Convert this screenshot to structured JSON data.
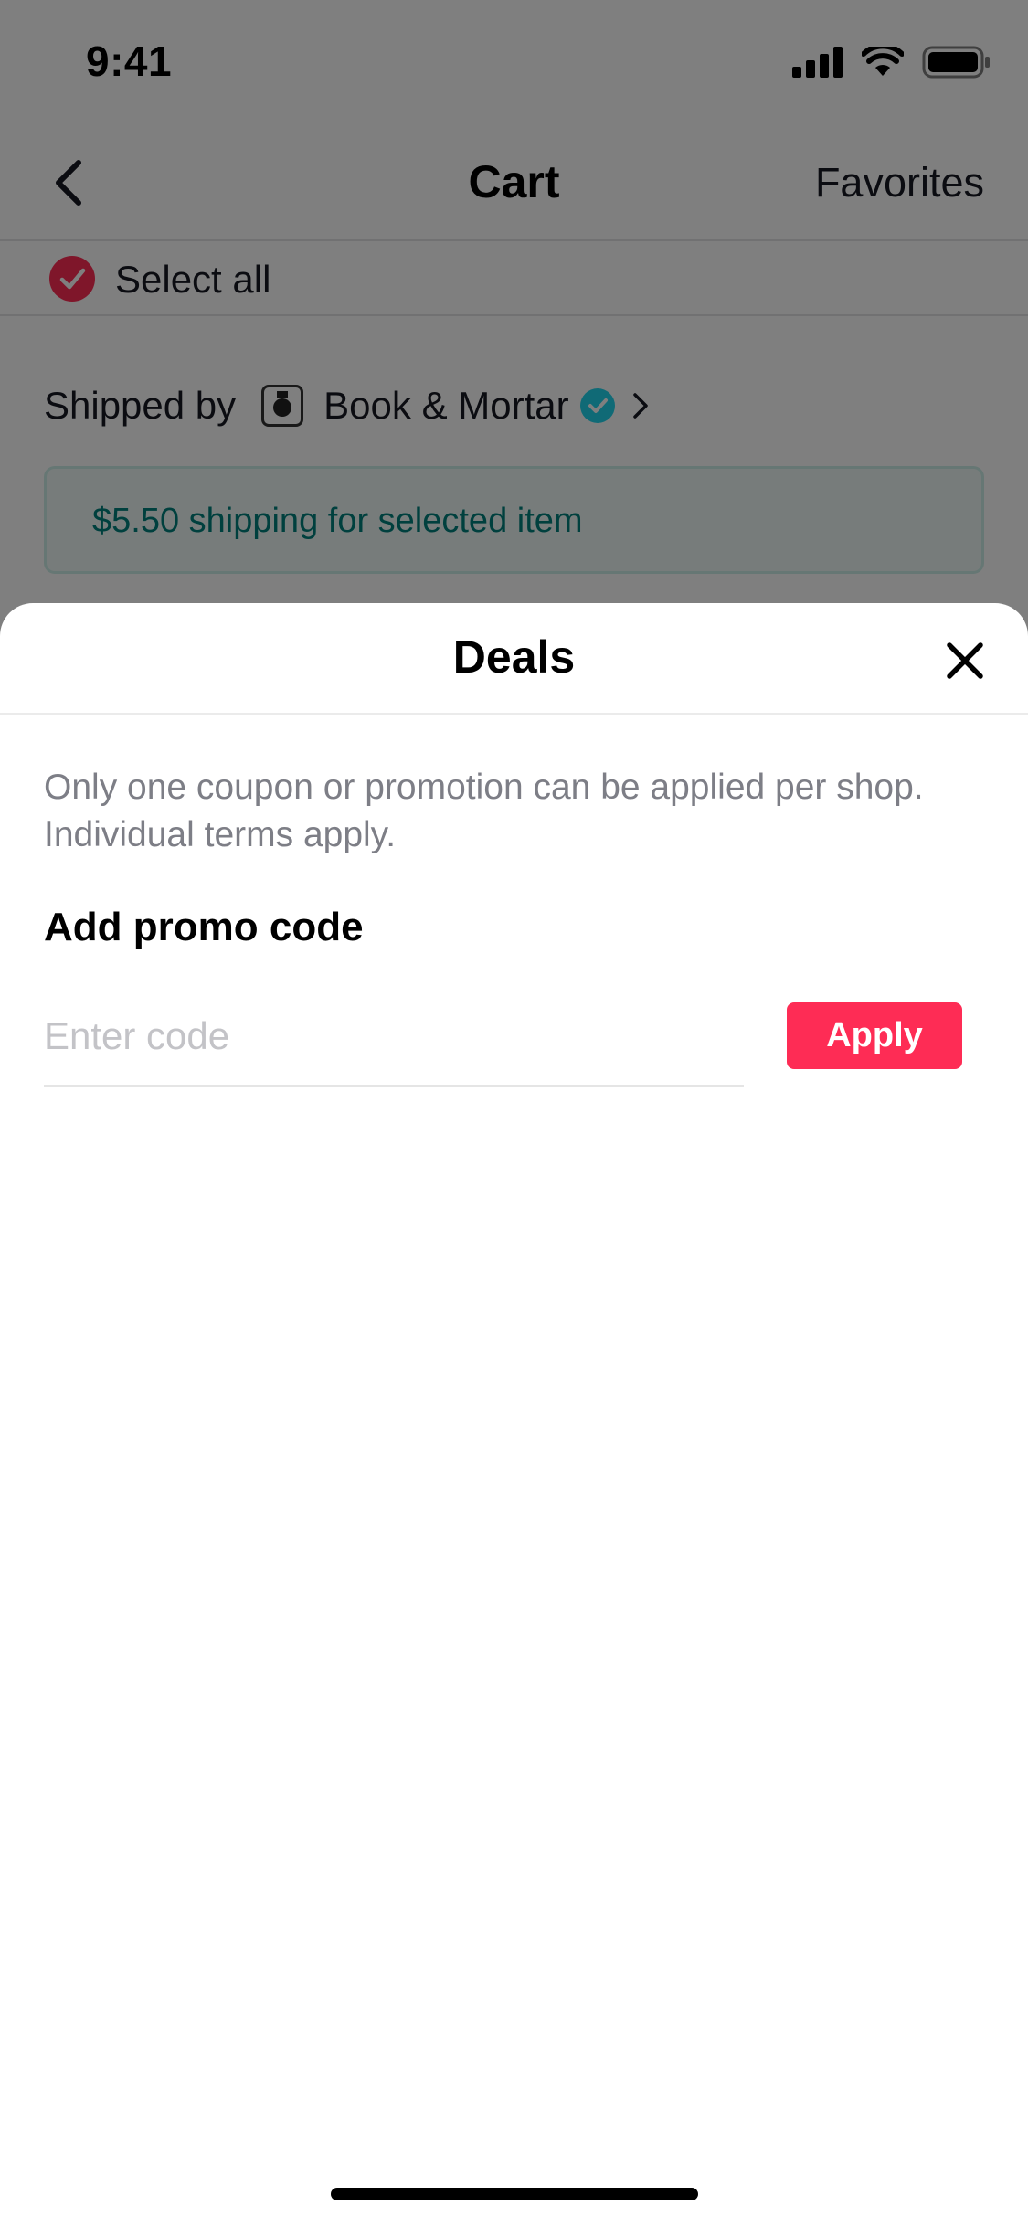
{
  "status_bar": {
    "time": "9:41",
    "icons": [
      "signal-icon",
      "wifi-icon",
      "battery-icon"
    ]
  },
  "nav": {
    "back_icon": "chevron-left-icon",
    "title": "Cart",
    "favorites_label": "Favorites"
  },
  "cart": {
    "select_all_label": "Select all",
    "select_all_checked": true,
    "shipped_by_label": "Shipped by",
    "shop_name": "Book & Mortar",
    "shop_verified": true,
    "shipping_note": "$5.50 shipping for selected item"
  },
  "deals_sheet": {
    "title": "Deals",
    "close_icon": "close-icon",
    "note": "Only one coupon or promotion can be applied per shop. Individual terms apply.",
    "promo_heading": "Add promo code",
    "code_input": {
      "value": "",
      "placeholder": "Enter code"
    },
    "apply_label": "Apply"
  },
  "colors": {
    "accent": "#fe2c55",
    "teal_text": "#00807c",
    "verified": "#20d5ec",
    "overlay": "rgba(0,0,0,0.5)"
  }
}
